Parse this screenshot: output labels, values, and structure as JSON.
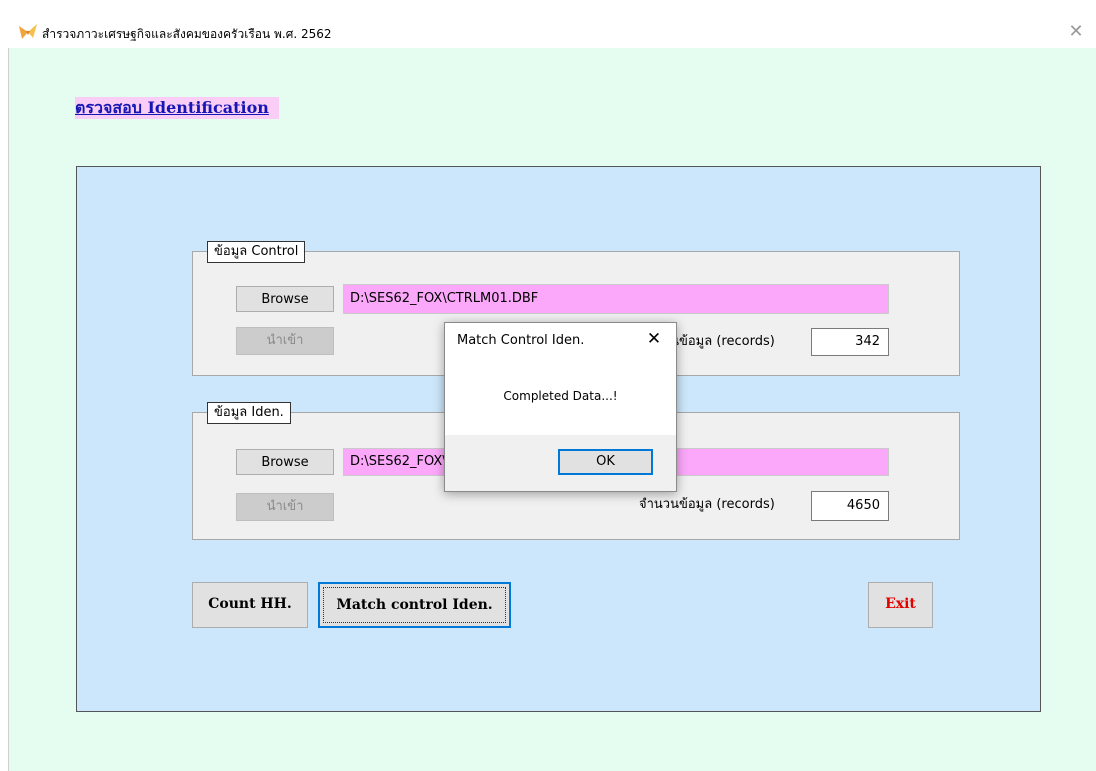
{
  "window": {
    "title": "สำรวจภาวะเศรษฐกิจและสังคมของครัวเรือน พ.ศ. 2562",
    "close_glyph": "✕"
  },
  "page": {
    "heading": "ตรวจสอบ Identification"
  },
  "control_group": {
    "label": "ข้อมูล Control",
    "browse_label": "Browse",
    "path_value": "D:\\SES62_FOX\\CTRLM01.DBF",
    "import_label": "นำเข้า",
    "count_label": "จำนวนข้อมูล (records)",
    "count_value": "342"
  },
  "iden_group": {
    "label": "ข้อมูล Iden.",
    "browse_label": "Browse",
    "path_value": "D:\\SES62_FOX\\",
    "import_label": "นำเข้า",
    "count_label": "จำนวนข้อมูล (records)",
    "count_value": "4650"
  },
  "actions": {
    "count_hh_label": "Count HH.",
    "match_label": "Match control Iden.",
    "exit_label": "Exit"
  },
  "dialog": {
    "title": "Match Control Iden.",
    "close_glyph": "✕",
    "message": "Completed Data...!",
    "ok_label": "OK"
  },
  "colors": {
    "client_bg": "#e5fdf1",
    "panel_bg": "#cce6fb",
    "path_bg": "#fca8fa",
    "heading_bg": "#f9cdf5",
    "heading_text": "#1616b4",
    "exit_text": "#e50000",
    "focus_border": "#0078d7"
  }
}
